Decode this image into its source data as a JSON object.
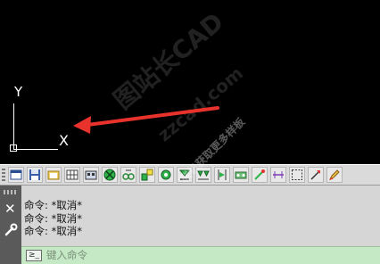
{
  "drawing_area": {
    "ucs": {
      "y_label": "Y",
      "x_label": "X"
    },
    "annotation": {
      "arrow_color": "#e8322c"
    },
    "watermark": {
      "line1": "图站长CAD",
      "line2": "zzcad.com",
      "line3": "联机获取更多样板"
    }
  },
  "toolbar": {
    "buttons": [
      {
        "icon": "layout-icon"
      },
      {
        "icon": "save-icon"
      },
      {
        "icon": "open-icon"
      },
      {
        "icon": "grid-icon"
      },
      {
        "icon": "block-icon"
      },
      {
        "icon": "circle-icon"
      },
      {
        "icon": "link-icon"
      },
      {
        "icon": "node-icon"
      },
      {
        "icon": "valve-icon"
      },
      {
        "icon": "symbol-icon"
      },
      {
        "icon": "fitting-icon"
      },
      {
        "icon": "split-icon"
      },
      {
        "icon": "device-icon"
      },
      {
        "icon": "pipe-icon"
      },
      {
        "icon": "dimension-icon"
      },
      {
        "icon": "selection-icon"
      },
      {
        "icon": "pointer-icon"
      },
      {
        "icon": "edit-icon"
      }
    ]
  },
  "command_panel": {
    "close_glyph": "✕",
    "history": [
      "命令: *取消*",
      "命令: *取消*",
      "命令: *取消*"
    ],
    "prompt_glyph": "≥_",
    "input": {
      "value": "",
      "placeholder": "键入命令"
    }
  }
}
